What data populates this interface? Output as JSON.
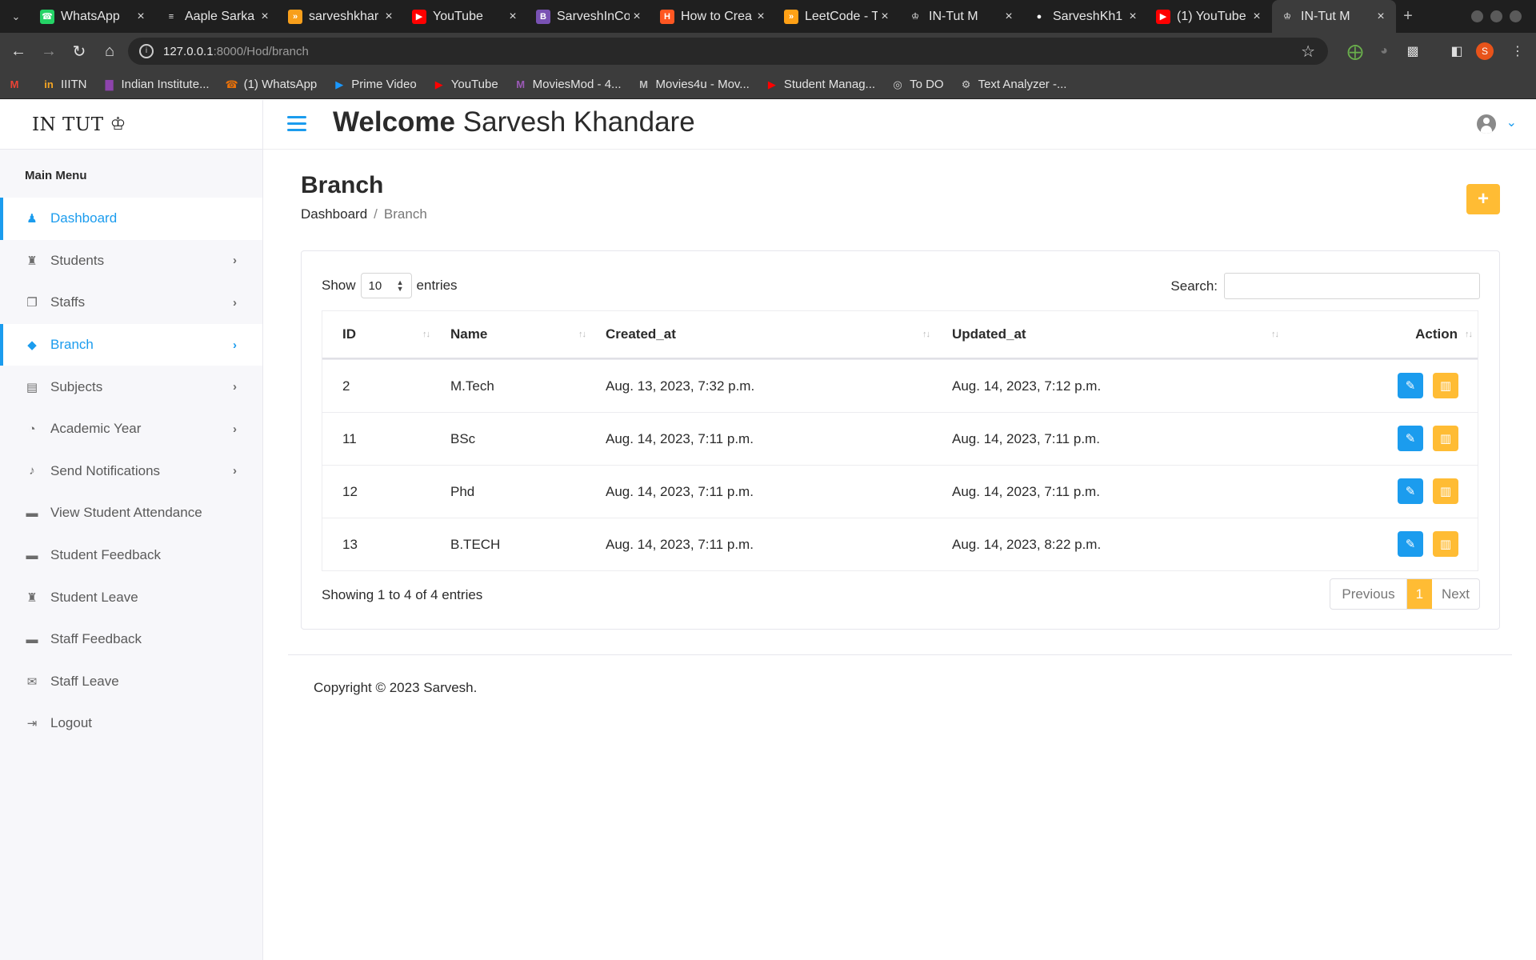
{
  "browser": {
    "tabs": [
      {
        "title": "WhatsApp",
        "icon": "whatsapp-icon",
        "color": "#25d366"
      },
      {
        "title": "Aaple Sarka",
        "icon": "doc-icon",
        "color": "#e8e8e8"
      },
      {
        "title": "sarveshkhar",
        "icon": "hackerrank-icon",
        "color": "#f89f1b"
      },
      {
        "title": "YouTube",
        "icon": "youtube-icon",
        "color": "#ff0000"
      },
      {
        "title": "SarveshInCo",
        "icon": "bootstrap-icon",
        "color": "#7952b3"
      },
      {
        "title": "How to Crea",
        "icon": "hackernoon-icon",
        "color": "#ff5722"
      },
      {
        "title": "LeetCode - T",
        "icon": "leetcode-icon",
        "color": "#ffa116"
      },
      {
        "title": "IN-Tut M",
        "icon": "seal-icon",
        "color": "#ffffff"
      },
      {
        "title": "SarveshKh1",
        "icon": "github-icon",
        "color": "#ffffff"
      },
      {
        "title": "(1) YouTube",
        "icon": "youtube-icon",
        "color": "#ff0000"
      },
      {
        "title": "IN-Tut M",
        "icon": "seal-icon",
        "color": "#ffffff",
        "active": true
      }
    ],
    "url_host": "127.0.0.1",
    "url_path": ":8000/Hod/branch",
    "profile_initial": "S",
    "bookmarks": [
      {
        "label": "",
        "icon": "gmail-icon",
        "color": "#ea4335"
      },
      {
        "label": "IIITN",
        "icon": "iiitn-icon",
        "color": "#f5a623"
      },
      {
        "label": "Indian Institute...",
        "icon": "chart-icon",
        "color": "#8e44ad"
      },
      {
        "label": "(1) WhatsApp",
        "icon": "whatsapp-icon",
        "color": "#e8710a"
      },
      {
        "label": "Prime Video",
        "icon": "prime-icon",
        "color": "#1a98ff"
      },
      {
        "label": "YouTube",
        "icon": "youtube-icon",
        "color": "#ff0000"
      },
      {
        "label": "MoviesMod - 4...",
        "icon": "m-icon",
        "color": "#9b59b6"
      },
      {
        "label": "Movies4u - Mov...",
        "icon": "m-icon",
        "color": "#c0c0c0"
      },
      {
        "label": "Student Manag...",
        "icon": "youtube-icon",
        "color": "#ff0000"
      },
      {
        "label": "To DO",
        "icon": "globe-icon",
        "color": "#cfcfcf"
      },
      {
        "label": "Text Analyzer -...",
        "icon": "gear-icon",
        "color": "#cfcfcf"
      }
    ]
  },
  "app": {
    "logo_text": "IN TUT",
    "welcome_bold": "Welcome",
    "welcome_name": "Sarvesh Khandare",
    "colors": {
      "accent": "#1b9cee",
      "warning": "#ffbc34"
    },
    "sidebar": {
      "title": "Main Menu",
      "items": [
        {
          "label": "Dashboard",
          "icon": "dashboard-icon",
          "chevron": false,
          "active": true
        },
        {
          "label": "Students",
          "icon": "student-icon",
          "chevron": true
        },
        {
          "label": "Staffs",
          "icon": "staff-icon",
          "chevron": true
        },
        {
          "label": "Branch",
          "icon": "graduation-cap-icon",
          "chevron": true,
          "active": true
        },
        {
          "label": "Subjects",
          "icon": "book-icon",
          "chevron": true
        },
        {
          "label": "Academic Year",
          "icon": "clock-icon",
          "chevron": true
        },
        {
          "label": "Send Notifications",
          "icon": "bell-icon",
          "chevron": true
        },
        {
          "label": "View Student Attendance",
          "icon": "comments-icon",
          "chevron": false
        },
        {
          "label": "Student Feedback",
          "icon": "comments-icon",
          "chevron": false
        },
        {
          "label": "Student Leave",
          "icon": "student-icon",
          "chevron": false
        },
        {
          "label": "Staff Feedback",
          "icon": "comments-icon",
          "chevron": false
        },
        {
          "label": "Staff Leave",
          "icon": "envelope-icon",
          "chevron": false
        },
        {
          "label": "Logout",
          "icon": "logout-icon",
          "chevron": false
        }
      ]
    },
    "page": {
      "title": "Branch",
      "breadcrumb": [
        "Dashboard",
        "Branch"
      ],
      "add_label": "+"
    },
    "table": {
      "show_label": "Show",
      "entries_label": "entries",
      "page_size": "10",
      "search_label": "Search:",
      "columns": [
        "ID",
        "Name",
        "Created_at",
        "Updated_at",
        "Action"
      ],
      "rows": [
        {
          "id": "2",
          "name": "M.Tech",
          "created": "Aug. 13, 2023, 7:32 p.m.",
          "updated": "Aug. 14, 2023, 7:12 p.m."
        },
        {
          "id": "11",
          "name": "BSc",
          "created": "Aug. 14, 2023, 7:11 p.m.",
          "updated": "Aug. 14, 2023, 7:11 p.m."
        },
        {
          "id": "12",
          "name": "Phd",
          "created": "Aug. 14, 2023, 7:11 p.m.",
          "updated": "Aug. 14, 2023, 7:11 p.m."
        },
        {
          "id": "13",
          "name": "B.TECH",
          "created": "Aug. 14, 2023, 7:11 p.m.",
          "updated": "Aug. 14, 2023, 8:22 p.m."
        }
      ],
      "info": "Showing 1 to 4 of 4 entries",
      "pager": {
        "previous": "Previous",
        "current": "1",
        "next": "Next"
      }
    },
    "footer": "Copyright © 2023 Sarvesh."
  }
}
